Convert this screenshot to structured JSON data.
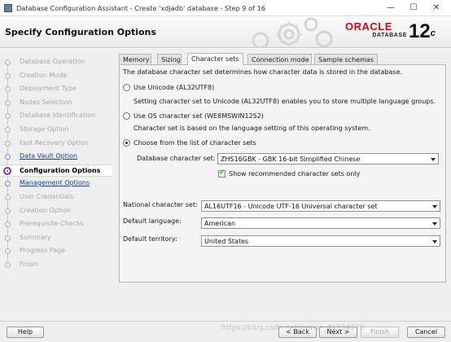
{
  "window": {
    "title": "Database Configuration Assistant - Create 'xdjadb' database - Step 9 of 16",
    "minimize": "—",
    "maximize": "☐",
    "close": "✕"
  },
  "header": {
    "title": "Specify Configuration Options",
    "oracle_word": "ORACLE",
    "database_word": "DATABASE",
    "version": "12",
    "version_sup": "c"
  },
  "steps": [
    {
      "label": "Database Operation",
      "state": "disabled"
    },
    {
      "label": "Creation Mode",
      "state": "disabled"
    },
    {
      "label": "Deployment Type",
      "state": "disabled"
    },
    {
      "label": "Nodes Selection",
      "state": "disabled"
    },
    {
      "label": "Database Identification",
      "state": "disabled"
    },
    {
      "label": "Storage Option",
      "state": "disabled"
    },
    {
      "label": "Fast Recovery Option",
      "state": "disabled"
    },
    {
      "label": "Data Vault Option",
      "state": "link"
    },
    {
      "label": "Configuration Options",
      "state": "current"
    },
    {
      "label": "Management Options",
      "state": "link"
    },
    {
      "label": "User Credentials",
      "state": "disabled"
    },
    {
      "label": "Creation Option",
      "state": "disabled"
    },
    {
      "label": "Prerequisite Checks",
      "state": "disabled"
    },
    {
      "label": "Summary",
      "state": "disabled"
    },
    {
      "label": "Progress Page",
      "state": "disabled"
    },
    {
      "label": "Finish",
      "state": "disabled"
    }
  ],
  "tabs": [
    {
      "label": "Memory"
    },
    {
      "label": "Sizing"
    },
    {
      "label": "Character sets",
      "active": true
    },
    {
      "label": "Connection mode"
    },
    {
      "label": "Sample schemas"
    }
  ],
  "charset": {
    "intro": "The database character set determines how character data is stored in the database.",
    "unicode_label": "Use Unicode (AL32UTF8)",
    "unicode_desc": "Setting character set to Unicode (AL32UTF8) enables you to store multiple language groups.",
    "os_label": "Use OS character set (WE8MSWIN1252)",
    "os_desc": "Character set is based on the language setting of this operating system.",
    "choose_label": "Choose from the list of character sets",
    "db_charset_label": "Database character set:",
    "db_charset_value": "ZHS16GBK - GBK 16-bit Simplified Chinese",
    "show_recommended": "Show recommended character sets only",
    "show_recommended_checked": true,
    "selected_option": "choose"
  },
  "national": {
    "label": "National character set:",
    "value": "AL16UTF16 - Unicode UTF-16 Universal character set"
  },
  "language": {
    "label": "Default language:",
    "value": "American"
  },
  "territory": {
    "label": "Default territory:",
    "value": "United States"
  },
  "footer": {
    "help": "Help",
    "back": "< Back",
    "next": "Next >",
    "finish": "Finish",
    "cancel": "Cancel"
  },
  "watermark": "https://blog.csdn.net/weixin_41154276",
  "colors": {
    "accent_purple": "#7a3aa6",
    "link_blue": "#1a3fa8",
    "oracle_red": "#e3000f"
  }
}
